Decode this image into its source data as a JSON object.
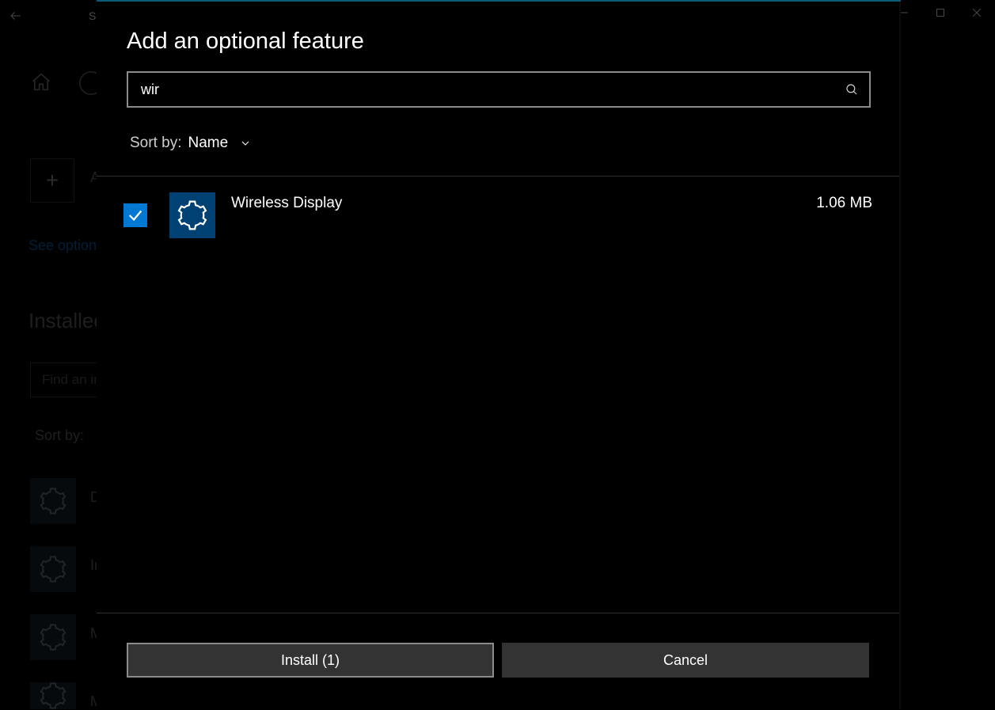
{
  "bg": {
    "app_title": "Settings",
    "add_label": "Add a feature",
    "link": "See optional features history",
    "installed_heading": "Installed features",
    "find_placeholder": "Find an installed feature",
    "sort_label": "Sort by:",
    "items": [
      {
        "label": "DirectX Configuration Database"
      },
      {
        "label": "Internet Explorer mode"
      },
      {
        "label": "Math Recognizer"
      },
      {
        "label": "Microsoft Paint"
      }
    ]
  },
  "dialog": {
    "title": "Add an optional feature",
    "search_value": "wir",
    "sort_label": "Sort by:",
    "sort_value": "Name",
    "feature": {
      "name": "Wireless Display",
      "size": "1.06 MB",
      "checked": true
    },
    "install_label": "Install (1)",
    "cancel_label": "Cancel"
  }
}
